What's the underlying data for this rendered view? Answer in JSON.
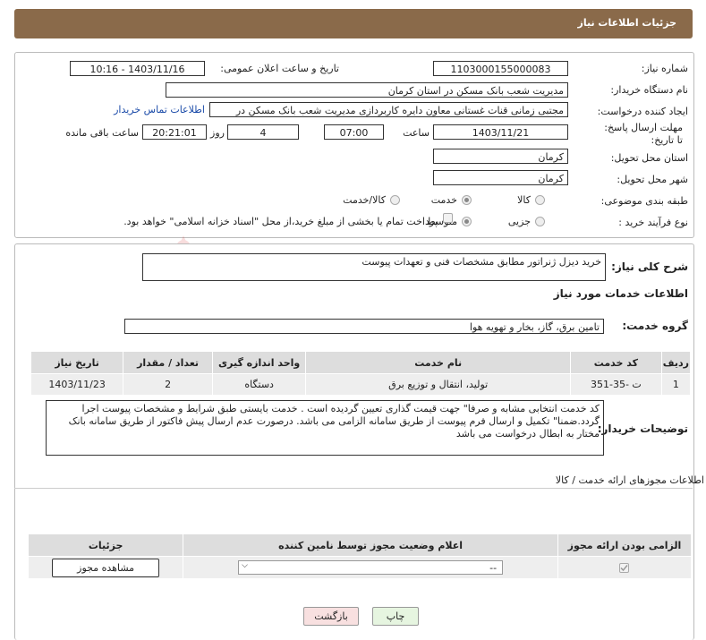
{
  "header": {
    "title": "جزئیات اطلاعات نیاز"
  },
  "form": {
    "need_number_label": "شماره نیاز:",
    "need_number": "1103000155000083",
    "announce_label": "تاریخ و ساعت اعلان عمومی:",
    "announce_value": "1403/11/16 - 10:16",
    "buyer_org_label": "نام دستگاه خریدار:",
    "buyer_org": "مدیریت شعب بانک مسکن در استان کرمان",
    "creator_label": "ایجاد کننده درخواست:",
    "creator": "مجتبی زمانی قنات غستانی معاون دایره کاربردازی مدیریت شعب بانک مسکن در",
    "contact_link": "اطلاعات تماس خریدار",
    "deadline_label": "مهلت ارسال پاسخ: تا تاریخ:",
    "deadline_date": "1403/11/21",
    "time_label": "ساعت",
    "deadline_time": "07:00",
    "days_value": "4",
    "days_label": "روز و",
    "remaining_time": "20:21:01",
    "remaining_label": "ساعت باقی مانده",
    "province_label": "استان محل تحویل:",
    "province": "کرمان",
    "city_label": "شهر محل تحویل:",
    "city": "کرمان",
    "category_label": "طبقه بندی موضوعی:",
    "category_options": [
      "کالا",
      "خدمت",
      "کالا/خدمت"
    ],
    "process_label": "نوع فرآیند خرید :",
    "process_options": [
      "جزیی",
      "متوسط"
    ],
    "treasury_note": "پرداخت تمام یا بخشی از مبلغ خرید،از محل \"اسناد خزانه اسلامی\" خواهد بود."
  },
  "summary": {
    "label": "شرح کلی نیاز:",
    "text": "خرید دیزل ژنراتور مطابق مشخصات فنی و تعهدات پیوست"
  },
  "services": {
    "section_title": "اطلاعات خدمات مورد نیاز",
    "group_label": "گروه خدمت:",
    "group_value": "تامین برق، گاز، بخار و تهویه هوا",
    "columns": [
      "ردیف",
      "کد خدمت",
      "نام خدمت",
      "واحد اندازه گیری",
      "تعداد / مقدار",
      "تاریخ نیاز"
    ],
    "rows": [
      [
        "1",
        "ت -35-351",
        "تولید، انتقال و توزیع برق",
        "دستگاه",
        "2",
        "1403/11/23"
      ]
    ]
  },
  "buyer_notes": {
    "label": "توضیحات خریدار:",
    "text": "کد خدمت انتخابی مشابه و صرفا\" جهت قیمت گذاری تعیین گردیده است . خدمت بایستی طبق شرایط و مشخصات پیوست اجرا گردد.ضمنا\" تکمیل و ارسال فرم پیوست از طریق سامانه الزامی می باشد. درصورت عدم ارسال پیش فاکتور از طریق سامانه بانک مختار به ابطال درخواست می باشد"
  },
  "permits": {
    "section_title": "اطلاعات مجوزهای ارائه خدمت / کالا",
    "columns": [
      "الزامی بودن ارائه مجوز",
      "اعلام وضعیت مجوز توسط نامین کننده",
      "جزئیات"
    ],
    "select_value": "--",
    "view_button": "مشاهده مجوز"
  },
  "footer": {
    "print_button": "چاپ",
    "back_button": "بازگشت"
  },
  "watermark": {
    "text": "AriaTender.neT"
  },
  "colors": {
    "header_bg": "#8a6a4a",
    "link": "#1a4aa8",
    "print_btn": "#e6f5e0",
    "back_btn": "#f8e0e0"
  }
}
